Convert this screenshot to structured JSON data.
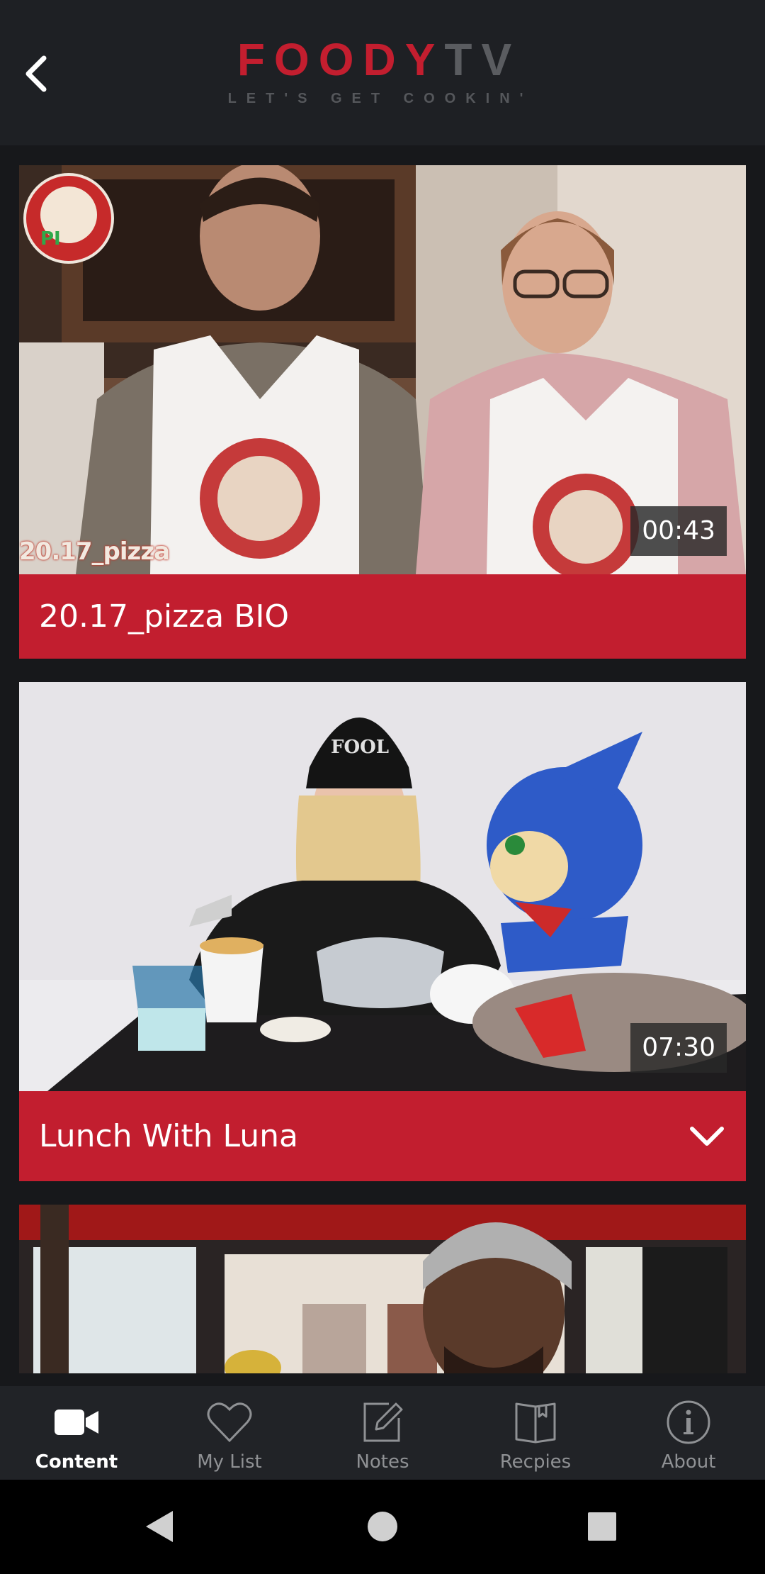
{
  "header": {
    "logo_red": "FOODY",
    "logo_gray": "TV",
    "tagline": "LET'S GET COOKIN'"
  },
  "videos": [
    {
      "title": "20.17_pizza BIO",
      "duration": "00:43",
      "overlay_text": "20.17_pizza",
      "expand_icon": false
    },
    {
      "title": "Lunch With Luna",
      "duration": "07:30",
      "expand_icon": "chevron-down-icon"
    }
  ],
  "nav": [
    {
      "label": "Content",
      "icon": "video-camera-icon",
      "active": true
    },
    {
      "label": "My List",
      "icon": "heart-icon",
      "active": false
    },
    {
      "label": "Notes",
      "icon": "pencil-note-icon",
      "active": false
    },
    {
      "label": "Recpies",
      "icon": "book-icon",
      "active": false
    },
    {
      "label": "About",
      "icon": "info-icon",
      "active": false
    }
  ],
  "colors": {
    "brand_red": "#c21e2f",
    "background": "#17181b",
    "header_bg": "#1e2024",
    "nav_bg": "#212327"
  }
}
